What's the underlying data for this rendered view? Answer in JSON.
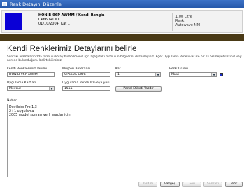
{
  "window": {
    "title": "Renk Detayını Düzenle"
  },
  "header": {
    "name_line": "HON B-96P AWMM / Kendi Rengin",
    "code": "CP660+CIOC",
    "date_line": "01/10/2004, Kat 1",
    "side_value": "1.00 Litre",
    "side_label1": "Renk",
    "side_label2": "Autowave MM",
    "swatch_color": "#0a00d6"
  },
  "page": {
    "title": "Kendi Renklerimiz Detaylarını belirle",
    "description_line1": "Sonraki aramalarınızda formülü kolay bulabilmeniz için aşağıdaki formülün bilgilerini düzenleyiniz. Eğer Uygulama Paneli var ise bir ID belirleyebilirsiniz veya panelin",
    "description_line2": "nerede bulunduğunu belirtebilirsiniz."
  },
  "form": {
    "color_name": {
      "label": "Kendi Renklerimiz Tanımı",
      "value": "HON B-96P AWMM"
    },
    "customer_ref": {
      "label": "Müşteri Referansı",
      "value": "CP660A CIOC"
    },
    "coat": {
      "label": "Kat",
      "value": "1"
    },
    "color_group": {
      "label": "Renk Grubu",
      "value": "Mavi",
      "swatch": "#1a2cc9"
    },
    "application_cards": {
      "label": "Uygulama Kartları",
      "value": "Mevcut"
    },
    "panel_id": {
      "label": "Uygulama Paneli ID veya yeri",
      "value": "1555"
    },
    "print_label_button": "Panel Etiketi Yazdır",
    "notes": {
      "label": "Notlar",
      "lines": [
        "Devilbiss Pro 1,3",
        "2+1 uygulama",
        "2005 model sonrası verli araçlar için"
      ]
    }
  },
  "footer": {
    "buttons": [
      "Yardım",
      "Vazgeç",
      "Geri",
      "Sonraki",
      "Bitir"
    ]
  }
}
